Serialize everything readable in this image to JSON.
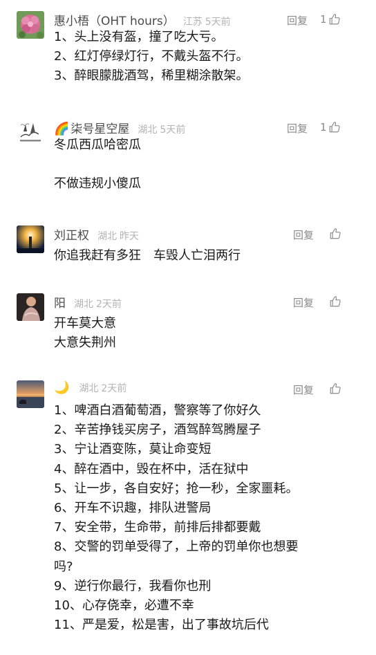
{
  "comments": [
    {
      "name": "惠小梧（OHT hours）",
      "location": "江苏",
      "time": "5天前",
      "reply": "回复",
      "likes": "1",
      "avatar_icon": "flower-avatar",
      "lines": [
        "1、头上没有盔，撞了吃大亏。",
        "2、红灯停绿灯行，不戴头盔不行。",
        "3、醉眼朦胧酒驾，稀里糊涂散架。"
      ]
    },
    {
      "name": "柒号星空屋",
      "name_emoji": "🌈",
      "location": "湖北",
      "time": "5天前",
      "reply": "回复",
      "likes": "1",
      "avatar_icon": "ink-painting-avatar",
      "lines": [
        "冬瓜西瓜哈密瓜",
        "不做违规小傻瓜"
      ]
    },
    {
      "name": "刘正权",
      "location": "湖北",
      "time": "昨天",
      "reply": "回复",
      "likes": "",
      "avatar_icon": "lighthouse-avatar",
      "lines": [
        "你追我赶有多狂　车毁人亡泪两行"
      ]
    },
    {
      "name": "阳",
      "location": "湖北",
      "time": "2天前",
      "reply": "回复",
      "likes": "",
      "avatar_icon": "person-avatar",
      "lines": [
        "开车莫大意",
        "大意失荆州"
      ]
    },
    {
      "name": "",
      "name_emoji": "🌙",
      "location": "湖北",
      "time": "2天前",
      "reply": "回复",
      "likes": "",
      "avatar_icon": "sunset-avatar",
      "lines": [
        "1、啤酒白酒葡萄酒，警察等了你好久",
        "2、辛苦挣钱买房子，酒驾醉驾腾屋子",
        "3、宁让酒变陈，莫让命变短",
        "4、醉在酒中，毁在杯中，活在狱中",
        "5、让一步，各自安好；抢一秒，全家噩耗。",
        "6、开车不识趣，排队进警局",
        "7、安全带，生命带，前排后排都要戴",
        "8、交警的罚单受得了，上帝的罚单你也想要",
        "吗?",
        "9、逆行你最行，我看你也刑",
        "10、心存侥幸，必遭不幸",
        "11、严是爱，松是害，出了事故坑后代"
      ]
    }
  ]
}
